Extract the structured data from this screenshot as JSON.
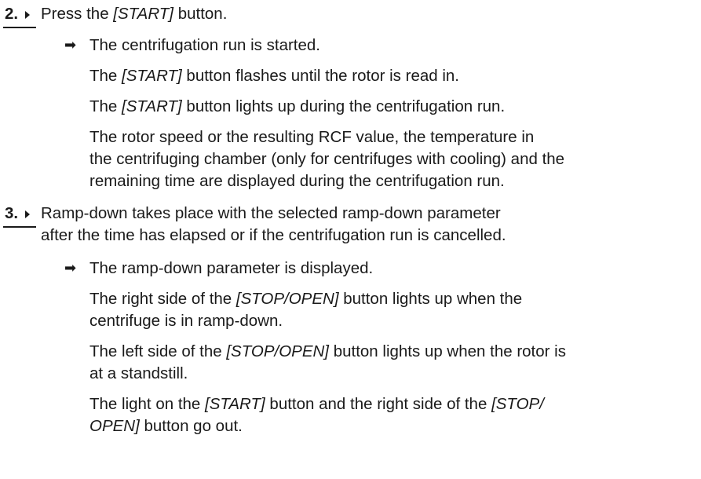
{
  "steps": [
    {
      "number": "2.",
      "text_parts": [
        "Press the ",
        "[START]",
        " button."
      ],
      "result": "The centrifugation run is started.",
      "paragraphs": [
        {
          "parts": [
            "The ",
            "[START]",
            " button flashes until the rotor is read in."
          ]
        },
        {
          "parts": [
            "The ",
            "[START]",
            " button lights up during the centrifugation run."
          ]
        },
        {
          "lines": [
            "The rotor speed or the resulting RCF value, the temperature in",
            "the centrifuging chamber (only for centrifuges with cooling) and the",
            "remaining time are displayed during the centrifugation run."
          ]
        }
      ]
    },
    {
      "number": "3.",
      "text_lines": [
        "Ramp-down takes place with the selected ramp-down parameter",
        "after the time has elapsed or if the centrifugation run is cancelled."
      ],
      "result": "The ramp-down parameter is displayed.",
      "paragraphs": [
        {
          "l1": [
            "The right side of the ",
            "[STOP/OPEN]",
            " button lights up when the"
          ],
          "l2": "centrifuge is in ramp-down."
        },
        {
          "l1": [
            "The left side of the ",
            "[STOP/OPEN]",
            " button lights up when the rotor is"
          ],
          "l2": "at a standstill."
        },
        {
          "l1": [
            "The light on the ",
            "[START]",
            " button and the right side of the ",
            "[STOP/"
          ],
          "l2": [
            "OPEN]",
            " button go out."
          ]
        }
      ]
    }
  ],
  "icons": {
    "step_marker": "step-arrow-icon",
    "result_marker": "result-arrow-icon",
    "result_glyph": "➡"
  }
}
